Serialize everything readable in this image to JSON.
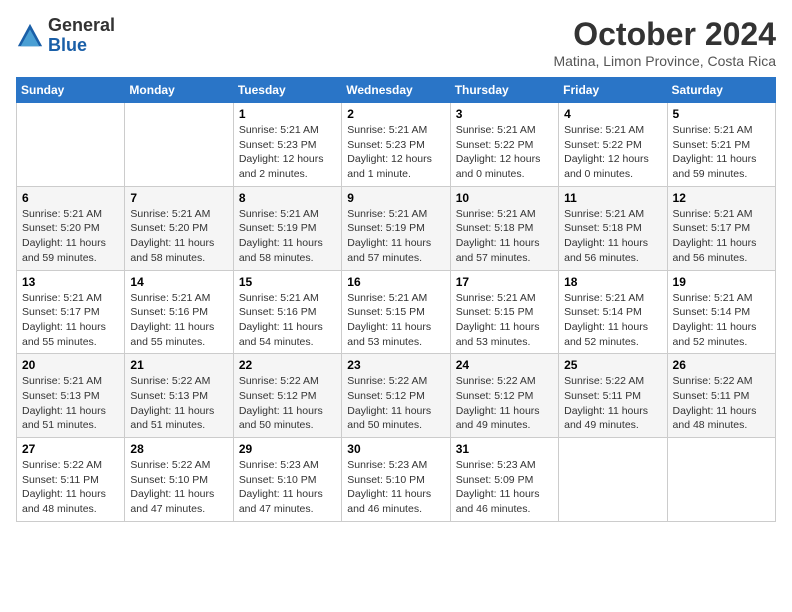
{
  "logo": {
    "general": "General",
    "blue": "Blue"
  },
  "header": {
    "month": "October 2024",
    "location": "Matina, Limon Province, Costa Rica"
  },
  "weekdays": [
    "Sunday",
    "Monday",
    "Tuesday",
    "Wednesday",
    "Thursday",
    "Friday",
    "Saturday"
  ],
  "weeks": [
    [
      {
        "day": "",
        "info": ""
      },
      {
        "day": "",
        "info": ""
      },
      {
        "day": "1",
        "info": "Sunrise: 5:21 AM\nSunset: 5:23 PM\nDaylight: 12 hours\nand 2 minutes."
      },
      {
        "day": "2",
        "info": "Sunrise: 5:21 AM\nSunset: 5:23 PM\nDaylight: 12 hours\nand 1 minute."
      },
      {
        "day": "3",
        "info": "Sunrise: 5:21 AM\nSunset: 5:22 PM\nDaylight: 12 hours\nand 0 minutes."
      },
      {
        "day": "4",
        "info": "Sunrise: 5:21 AM\nSunset: 5:22 PM\nDaylight: 12 hours\nand 0 minutes."
      },
      {
        "day": "5",
        "info": "Sunrise: 5:21 AM\nSunset: 5:21 PM\nDaylight: 11 hours\nand 59 minutes."
      }
    ],
    [
      {
        "day": "6",
        "info": "Sunrise: 5:21 AM\nSunset: 5:20 PM\nDaylight: 11 hours\nand 59 minutes."
      },
      {
        "day": "7",
        "info": "Sunrise: 5:21 AM\nSunset: 5:20 PM\nDaylight: 11 hours\nand 58 minutes."
      },
      {
        "day": "8",
        "info": "Sunrise: 5:21 AM\nSunset: 5:19 PM\nDaylight: 11 hours\nand 58 minutes."
      },
      {
        "day": "9",
        "info": "Sunrise: 5:21 AM\nSunset: 5:19 PM\nDaylight: 11 hours\nand 57 minutes."
      },
      {
        "day": "10",
        "info": "Sunrise: 5:21 AM\nSunset: 5:18 PM\nDaylight: 11 hours\nand 57 minutes."
      },
      {
        "day": "11",
        "info": "Sunrise: 5:21 AM\nSunset: 5:18 PM\nDaylight: 11 hours\nand 56 minutes."
      },
      {
        "day": "12",
        "info": "Sunrise: 5:21 AM\nSunset: 5:17 PM\nDaylight: 11 hours\nand 56 minutes."
      }
    ],
    [
      {
        "day": "13",
        "info": "Sunrise: 5:21 AM\nSunset: 5:17 PM\nDaylight: 11 hours\nand 55 minutes."
      },
      {
        "day": "14",
        "info": "Sunrise: 5:21 AM\nSunset: 5:16 PM\nDaylight: 11 hours\nand 55 minutes."
      },
      {
        "day": "15",
        "info": "Sunrise: 5:21 AM\nSunset: 5:16 PM\nDaylight: 11 hours\nand 54 minutes."
      },
      {
        "day": "16",
        "info": "Sunrise: 5:21 AM\nSunset: 5:15 PM\nDaylight: 11 hours\nand 53 minutes."
      },
      {
        "day": "17",
        "info": "Sunrise: 5:21 AM\nSunset: 5:15 PM\nDaylight: 11 hours\nand 53 minutes."
      },
      {
        "day": "18",
        "info": "Sunrise: 5:21 AM\nSunset: 5:14 PM\nDaylight: 11 hours\nand 52 minutes."
      },
      {
        "day": "19",
        "info": "Sunrise: 5:21 AM\nSunset: 5:14 PM\nDaylight: 11 hours\nand 52 minutes."
      }
    ],
    [
      {
        "day": "20",
        "info": "Sunrise: 5:21 AM\nSunset: 5:13 PM\nDaylight: 11 hours\nand 51 minutes."
      },
      {
        "day": "21",
        "info": "Sunrise: 5:22 AM\nSunset: 5:13 PM\nDaylight: 11 hours\nand 51 minutes."
      },
      {
        "day": "22",
        "info": "Sunrise: 5:22 AM\nSunset: 5:12 PM\nDaylight: 11 hours\nand 50 minutes."
      },
      {
        "day": "23",
        "info": "Sunrise: 5:22 AM\nSunset: 5:12 PM\nDaylight: 11 hours\nand 50 minutes."
      },
      {
        "day": "24",
        "info": "Sunrise: 5:22 AM\nSunset: 5:12 PM\nDaylight: 11 hours\nand 49 minutes."
      },
      {
        "day": "25",
        "info": "Sunrise: 5:22 AM\nSunset: 5:11 PM\nDaylight: 11 hours\nand 49 minutes."
      },
      {
        "day": "26",
        "info": "Sunrise: 5:22 AM\nSunset: 5:11 PM\nDaylight: 11 hours\nand 48 minutes."
      }
    ],
    [
      {
        "day": "27",
        "info": "Sunrise: 5:22 AM\nSunset: 5:11 PM\nDaylight: 11 hours\nand 48 minutes."
      },
      {
        "day": "28",
        "info": "Sunrise: 5:22 AM\nSunset: 5:10 PM\nDaylight: 11 hours\nand 47 minutes."
      },
      {
        "day": "29",
        "info": "Sunrise: 5:23 AM\nSunset: 5:10 PM\nDaylight: 11 hours\nand 47 minutes."
      },
      {
        "day": "30",
        "info": "Sunrise: 5:23 AM\nSunset: 5:10 PM\nDaylight: 11 hours\nand 46 minutes."
      },
      {
        "day": "31",
        "info": "Sunrise: 5:23 AM\nSunset: 5:09 PM\nDaylight: 11 hours\nand 46 minutes."
      },
      {
        "day": "",
        "info": ""
      },
      {
        "day": "",
        "info": ""
      }
    ]
  ]
}
